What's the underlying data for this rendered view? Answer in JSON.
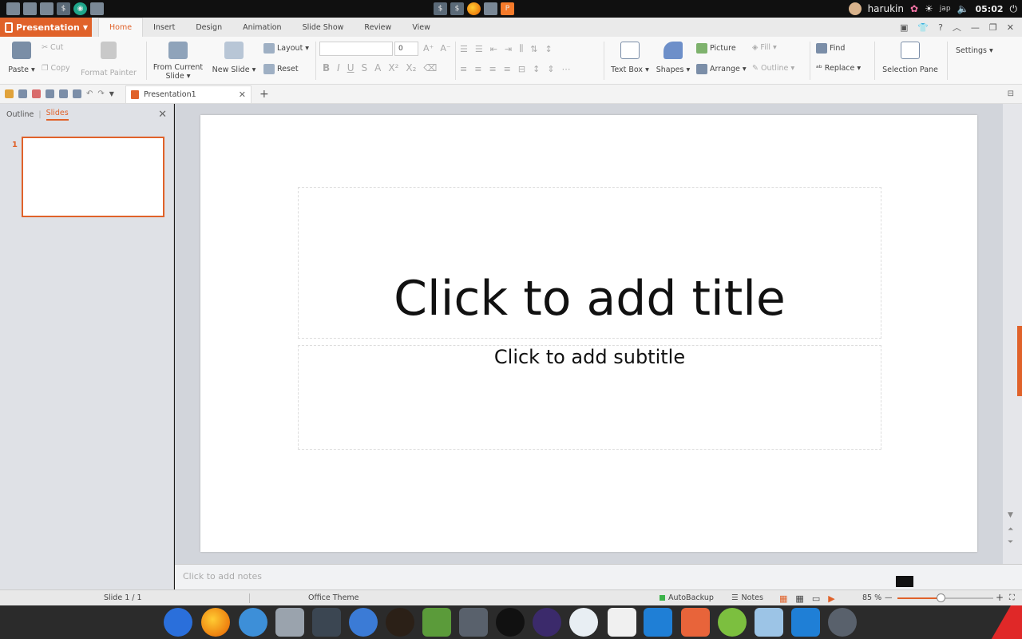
{
  "system_panel": {
    "user": "harukin",
    "layout_indicator": "jap",
    "clock": "05:02"
  },
  "app": {
    "name": "Presentation",
    "tabs": [
      "Home",
      "Insert",
      "Design",
      "Animation",
      "Slide Show",
      "Review",
      "View"
    ],
    "active_tab": "Home"
  },
  "ribbon": {
    "paste": "Paste",
    "cut": "Cut",
    "copy": "Copy",
    "format_painter": "Format Painter",
    "from_current_slide": "From Current",
    "from_current_slide_2": "Slide",
    "new_slide": "New Slide",
    "layout": "Layout",
    "reset": "Reset",
    "font_size": "0",
    "text_box": "Text Box",
    "shapes": "Shapes",
    "picture": "Picture",
    "arrange": "Arrange",
    "fill": "Fill",
    "outline": "Outline",
    "find": "Find",
    "replace": "Replace",
    "selection_pane": "Selection Pane",
    "settings": "Settings"
  },
  "document_tab": "Presentation1",
  "left_panel": {
    "tab_outline": "Outline",
    "tab_slides": "Slides",
    "active": "Slides",
    "slide_number": "1"
  },
  "slide": {
    "title_placeholder": "Click to add title",
    "subtitle_placeholder": "Click to add subtitle"
  },
  "notes_placeholder": "Click to add notes",
  "status_bar": {
    "slide_indicator": "Slide 1 / 1",
    "theme": "Office Theme",
    "autobackup": "AutoBackup",
    "notes": "Notes",
    "zoom": "85 %",
    "zoom_fraction": 0.45
  },
  "colors": {
    "accent": "#e0622a",
    "app_button": "#e0622a"
  }
}
